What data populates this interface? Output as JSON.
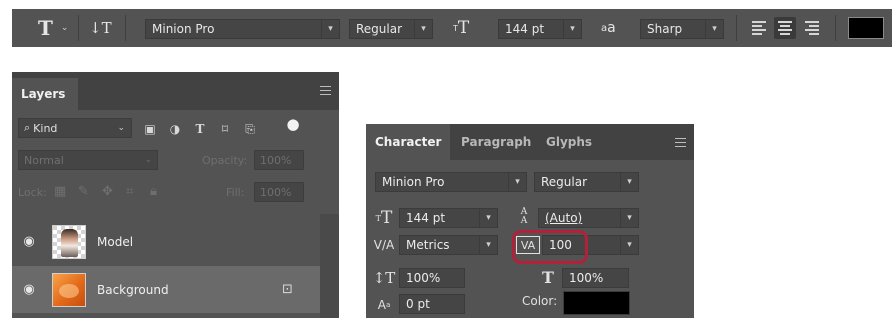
{
  "options_bar": {
    "tool_glyph": "T",
    "orientation_glyph": "↓T",
    "font_family": "Minion Pro",
    "font_style": "Regular",
    "size_glyph": "T",
    "font_size": "144 pt",
    "aa_glyph": "a",
    "antialias": "Sharp",
    "text_color": "#000000"
  },
  "layers_panel": {
    "tab": "Layers",
    "filter_kind": "Kind",
    "blend_mode": "Normal",
    "opacity_label": "Opacity:",
    "opacity_value": "100%",
    "lock_label": "Lock:",
    "fill_label": "Fill:",
    "fill_value": "100%",
    "layers": [
      {
        "name": "Model",
        "locked": false
      },
      {
        "name": "Background",
        "locked": true
      }
    ]
  },
  "character_panel": {
    "tabs": [
      "Character",
      "Paragraph",
      "Glyphs"
    ],
    "font_family": "Minion Pro",
    "font_style": "Regular",
    "font_size": "144 pt",
    "leading": "(Auto)",
    "kerning": "Metrics",
    "tracking": "100",
    "vertical_scale": "100%",
    "horizontal_scale": "100%",
    "baseline_shift": "0 pt",
    "color_label": "Color:",
    "color_value": "#000000",
    "highlighted_field": "tracking",
    "highlight_color": "#b3203a"
  }
}
